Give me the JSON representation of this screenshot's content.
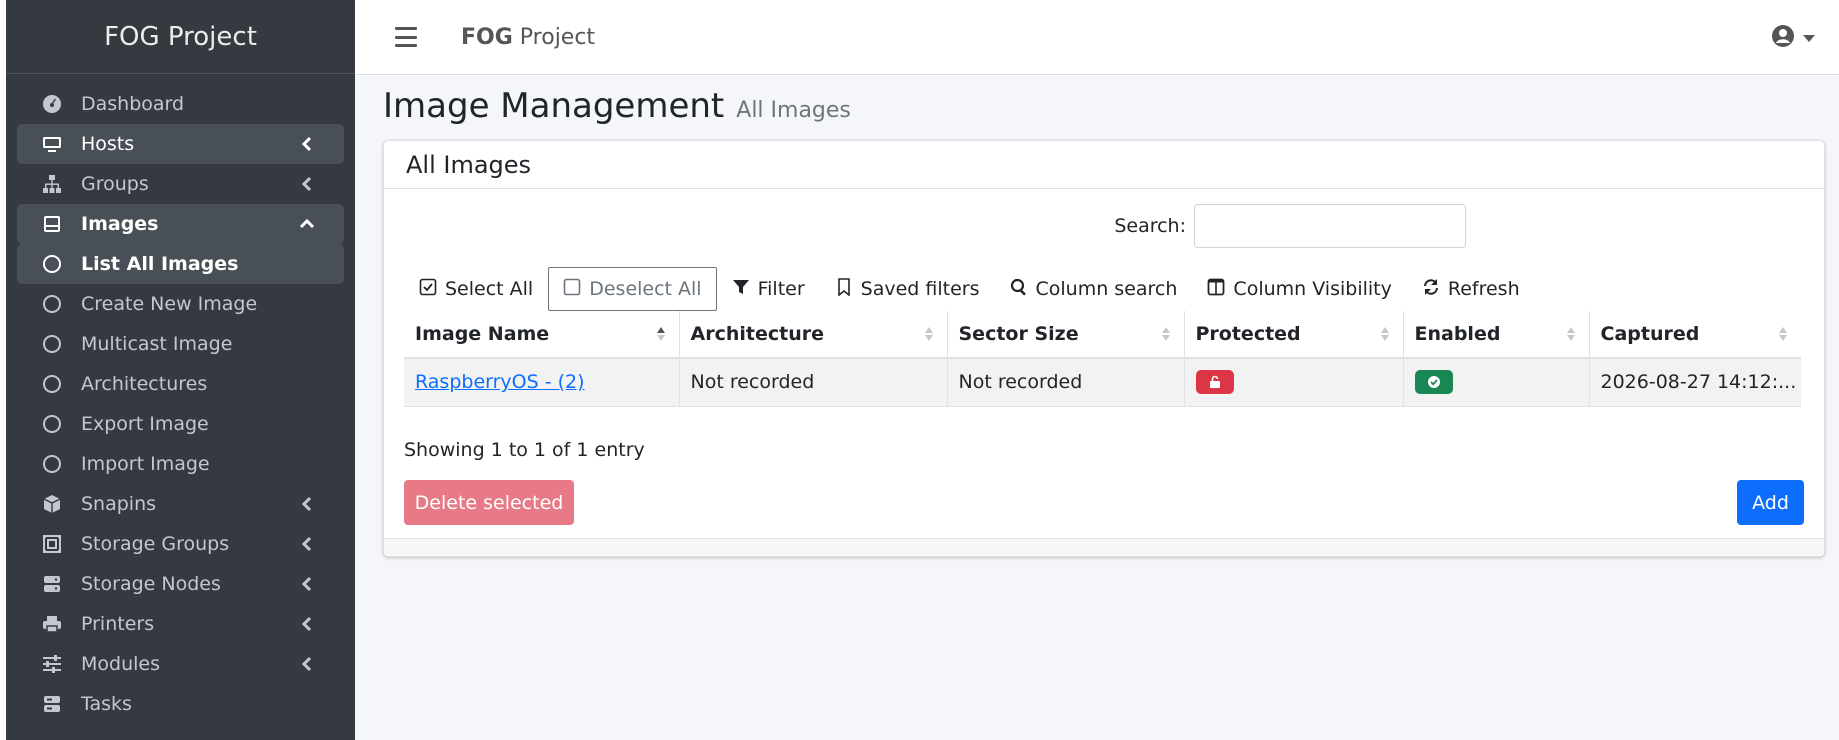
{
  "sidebar": {
    "brand": "FOG Project",
    "items": [
      {
        "label": "Dashboard",
        "icon": "dashboard-icon"
      },
      {
        "label": "Hosts",
        "icon": "desktop-icon"
      },
      {
        "label": "Groups",
        "icon": "sitemap-icon"
      },
      {
        "label": "Images",
        "icon": "hdd-icon"
      },
      {
        "label": "List All Images",
        "icon": "circle-icon"
      },
      {
        "label": "Create New Image",
        "icon": "circle-icon"
      },
      {
        "label": "Multicast Image",
        "icon": "circle-icon"
      },
      {
        "label": "Architectures",
        "icon": "circle-icon"
      },
      {
        "label": "Export Image",
        "icon": "circle-icon"
      },
      {
        "label": "Import Image",
        "icon": "circle-icon"
      },
      {
        "label": "Snapins",
        "icon": "box-icon"
      },
      {
        "label": "Storage Groups",
        "icon": "storage-group-icon"
      },
      {
        "label": "Storage Nodes",
        "icon": "server-icon"
      },
      {
        "label": "Printers",
        "icon": "printer-icon"
      },
      {
        "label": "Modules",
        "icon": "sliders-icon"
      },
      {
        "label": "Tasks",
        "icon": "tasks-icon"
      }
    ]
  },
  "topbar": {
    "brand_bold": "FOG",
    "brand_rest": " Project"
  },
  "page": {
    "title": "Image Management",
    "subtitle": "All Images"
  },
  "card": {
    "title": "All Images",
    "search_label": "Search:",
    "search_value": "",
    "toolbar": {
      "select_all": "Select All",
      "deselect_all": "Deselect All",
      "filter": "Filter",
      "saved_filters": "Saved filters",
      "column_search": "Column search",
      "column_visibility": "Column Visibility",
      "refresh": "Refresh"
    },
    "table": {
      "headers": [
        "Image Name",
        "Architecture",
        "Sector Size",
        "Protected",
        "Enabled",
        "Captured"
      ],
      "rows": [
        {
          "name": "RaspberryOS - (2)",
          "architecture": "Not recorded",
          "sector_size": "Not recorded",
          "protected": "unlocked",
          "enabled": "enabled",
          "captured": "2026-08-27 14:12:..."
        }
      ]
    },
    "info": "Showing 1 to 1 of 1 entry",
    "delete_label": "Delete selected",
    "add_label": "Add"
  },
  "colors": {
    "sidebar_bg": "#343a40",
    "primary": "#0d6efd",
    "danger": "#dc3545",
    "success": "#198754"
  }
}
